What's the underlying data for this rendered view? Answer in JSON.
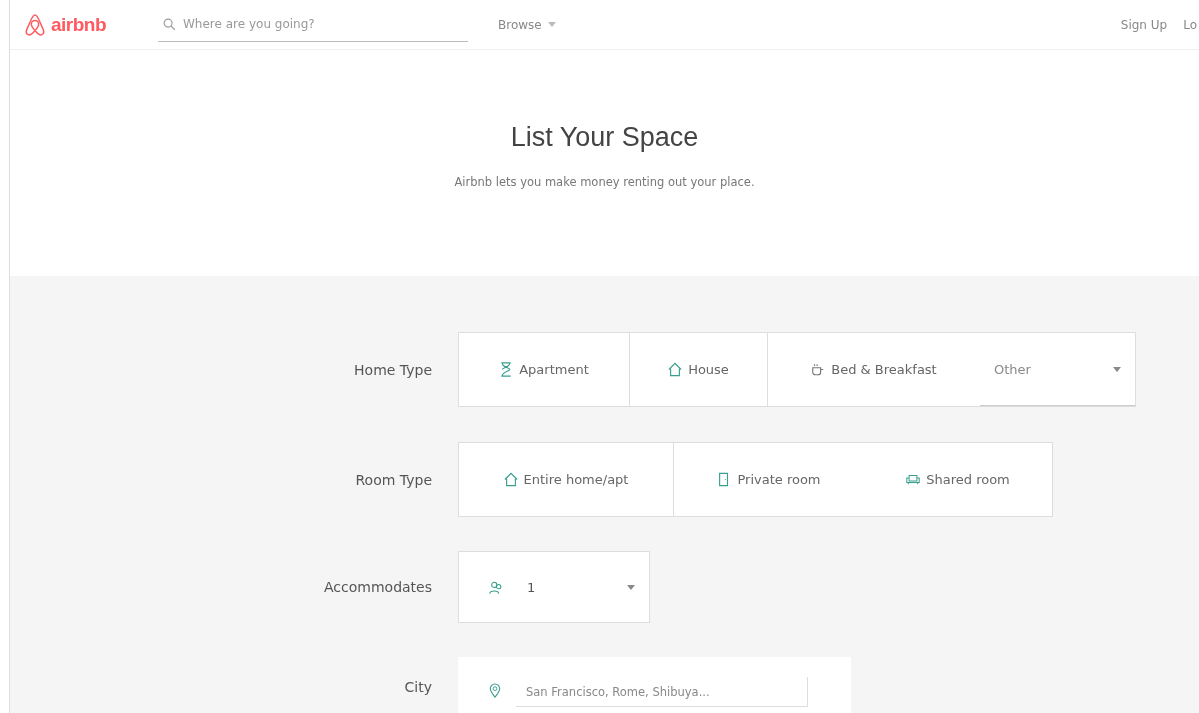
{
  "header": {
    "logo": "airbnb",
    "search": {
      "placeholder": "Where are you going?"
    },
    "browse": "Browse",
    "links": [
      "Sign Up",
      "Lo"
    ]
  },
  "hero": {
    "title": "List Your Space",
    "subtitle": "Airbnb lets you make money renting out your place."
  },
  "form": {
    "home_type": {
      "label": "Home Type",
      "options": [
        {
          "label": "Apartment",
          "kind": "apartment"
        },
        {
          "label": "House",
          "kind": "house"
        },
        {
          "label": "Bed & Breakfast",
          "kind": "bed"
        }
      ],
      "other": "Other"
    },
    "room_type": {
      "label": "Room Type",
      "options": [
        {
          "label": "Entire home/apt",
          "kind": "house"
        },
        {
          "label": "Private room",
          "kind": "door"
        },
        {
          "label": "Shared room",
          "kind": "sofa"
        }
      ]
    },
    "accommodates": {
      "label": "Accommodates",
      "value": "1"
    },
    "city": {
      "label": "City",
      "placeholder": "San Francisco, Rome, Shibuya..."
    }
  }
}
